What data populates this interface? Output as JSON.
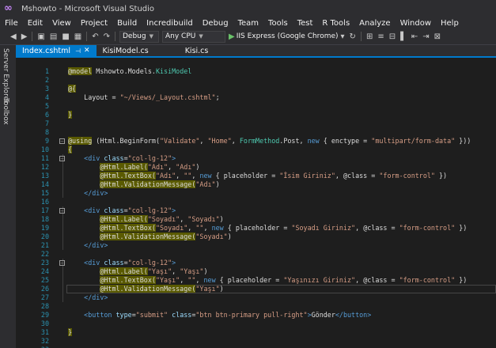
{
  "window": {
    "title": "Mshowto - Microsoft Visual Studio"
  },
  "menu": [
    "File",
    "Edit",
    "View",
    "Project",
    "Build",
    "Incredibuild",
    "Debug",
    "Team",
    "Tools",
    "Test",
    "R Tools",
    "Analyze",
    "Window",
    "Help"
  ],
  "toolbar": {
    "config": "Debug",
    "platform": "Any CPU",
    "run_target": "IIS Express (Google Chrome)"
  },
  "side_tabs": [
    "Server Explorer",
    "Toolbox"
  ],
  "tabs": [
    {
      "label": "Index.cshtml",
      "active": true
    },
    {
      "label": "KisiModel.cs",
      "active": false
    },
    {
      "label": "Kisi.cs",
      "active": false
    }
  ],
  "colors": {
    "accent": "#007acc",
    "line_number": "#2b91af",
    "keyword": "#569cd6",
    "string": "#d69d85",
    "type": "#4ec9b0"
  },
  "icons": [
    "vs-logo-icon",
    "back-icon",
    "forward-icon",
    "new-item-icon",
    "open-icon",
    "save-icon",
    "save-all-icon",
    "undo-icon",
    "redo-icon",
    "play-icon",
    "refresh-icon"
  ],
  "code_lines": [
    {
      "n": "1",
      "segs": [
        [
          "razor",
          "@model"
        ],
        [
          "",
          " Mshowto.Models."
        ],
        [
          "type",
          "KisiModel"
        ]
      ]
    },
    {
      "n": "2",
      "segs": [
        [
          "",
          ""
        ]
      ]
    },
    {
      "n": "3",
      "segs": [
        [
          "razor",
          "@{"
        ]
      ]
    },
    {
      "n": "4",
      "segs": [
        [
          "",
          "    Layout = "
        ],
        [
          "str",
          "\"~/Views/_Layout.cshtml\""
        ],
        [
          "",
          ";"
        ]
      ]
    },
    {
      "n": "5",
      "segs": [
        [
          "",
          ""
        ]
      ]
    },
    {
      "n": "6",
      "segs": [
        [
          "razor",
          "}"
        ]
      ]
    },
    {
      "n": "7",
      "segs": [
        [
          "",
          ""
        ]
      ]
    },
    {
      "n": "8",
      "segs": [
        [
          "",
          ""
        ]
      ]
    },
    {
      "n": "9",
      "segs": [
        [
          "razor",
          "@using"
        ],
        [
          "",
          " (Html.BeginForm("
        ],
        [
          "str",
          "\"Validate\""
        ],
        [
          "",
          ", "
        ],
        [
          "str",
          "\"Home\""
        ],
        [
          "",
          ", "
        ],
        [
          "type",
          "FormMethod"
        ],
        [
          "",
          ".Post, "
        ],
        [
          "kw",
          "new"
        ],
        [
          "",
          " { enctype = "
        ],
        [
          "str",
          "\"multipart/form-data\""
        ],
        [
          "",
          " }))"
        ]
      ]
    },
    {
      "n": "10",
      "segs": [
        [
          "razor",
          "{"
        ]
      ]
    },
    {
      "n": "11",
      "segs": [
        [
          "",
          "    "
        ],
        [
          "tag",
          "<div"
        ],
        [
          "attr",
          " class"
        ],
        [
          "",
          "="
        ],
        [
          "str",
          "\"col-lg-12\""
        ],
        [
          "tag",
          ">"
        ]
      ]
    },
    {
      "n": "12",
      "segs": [
        [
          "",
          "        "
        ],
        [
          "razor",
          "@Html.Label("
        ],
        [
          "str",
          "\"Adı\""
        ],
        [
          "",
          ", "
        ],
        [
          "str",
          "\"Adı\""
        ],
        [
          "",
          ")"
        ]
      ]
    },
    {
      "n": "13",
      "segs": [
        [
          "",
          "        "
        ],
        [
          "razor",
          "@Html.TextBox("
        ],
        [
          "str",
          "\"Adı\""
        ],
        [
          "",
          ", "
        ],
        [
          "str",
          "\"\""
        ],
        [
          "",
          ", "
        ],
        [
          "kw",
          "new"
        ],
        [
          "",
          " { placeholder = "
        ],
        [
          "str",
          "\"İsim Giriniz\""
        ],
        [
          "",
          ", @class = "
        ],
        [
          "str",
          "\"form-control\""
        ],
        [
          "",
          " })"
        ]
      ]
    },
    {
      "n": "14",
      "segs": [
        [
          "",
          "        "
        ],
        [
          "razor",
          "@Html.ValidationMessage("
        ],
        [
          "str",
          "\"Adı\""
        ],
        [
          "",
          ")"
        ]
      ]
    },
    {
      "n": "15",
      "segs": [
        [
          "",
          "    "
        ],
        [
          "tag",
          "</div>"
        ]
      ]
    },
    {
      "n": "16",
      "segs": [
        [
          "",
          ""
        ]
      ]
    },
    {
      "n": "17",
      "segs": [
        [
          "",
          "    "
        ],
        [
          "tag",
          "<div"
        ],
        [
          "attr",
          " class"
        ],
        [
          "",
          "="
        ],
        [
          "str",
          "\"col-lg-12\""
        ],
        [
          "tag",
          ">"
        ]
      ]
    },
    {
      "n": "18",
      "segs": [
        [
          "",
          "        "
        ],
        [
          "razor",
          "@Html.Label("
        ],
        [
          "str",
          "\"Soyadı\""
        ],
        [
          "",
          ", "
        ],
        [
          "str",
          "\"Soyadı\""
        ],
        [
          "",
          ")"
        ]
      ]
    },
    {
      "n": "19",
      "segs": [
        [
          "",
          "        "
        ],
        [
          "razor",
          "@Html.TextBox("
        ],
        [
          "str",
          "\"Soyadı\""
        ],
        [
          "",
          ", "
        ],
        [
          "str",
          "\"\""
        ],
        [
          "",
          ", "
        ],
        [
          "kw",
          "new"
        ],
        [
          "",
          " { placeholder = "
        ],
        [
          "str",
          "\"Soyadı Giriniz\""
        ],
        [
          "",
          ", @class = "
        ],
        [
          "str",
          "\"form-control\""
        ],
        [
          "",
          " })"
        ]
      ]
    },
    {
      "n": "20",
      "segs": [
        [
          "",
          "        "
        ],
        [
          "razor",
          "@Html.ValidationMessage("
        ],
        [
          "str",
          "\"Soyadı\""
        ],
        [
          "",
          ")"
        ]
      ]
    },
    {
      "n": "21",
      "segs": [
        [
          "",
          "    "
        ],
        [
          "tag",
          "</div>"
        ]
      ]
    },
    {
      "n": "22",
      "segs": [
        [
          "",
          ""
        ]
      ]
    },
    {
      "n": "23",
      "segs": [
        [
          "",
          "    "
        ],
        [
          "tag",
          "<div"
        ],
        [
          "attr",
          " class"
        ],
        [
          "",
          "="
        ],
        [
          "str",
          "\"col-lg-12\""
        ],
        [
          "tag",
          ">"
        ]
      ]
    },
    {
      "n": "24",
      "segs": [
        [
          "",
          "        "
        ],
        [
          "razor",
          "@Html.Label("
        ],
        [
          "str",
          "\"Yaşı\""
        ],
        [
          "",
          ", "
        ],
        [
          "str",
          "\"Yaşı\""
        ],
        [
          "",
          ")"
        ]
      ]
    },
    {
      "n": "25",
      "segs": [
        [
          "",
          "        "
        ],
        [
          "razor",
          "@Html.TextBox("
        ],
        [
          "str",
          "\"Yaşı\""
        ],
        [
          "",
          ", "
        ],
        [
          "str",
          "\"\""
        ],
        [
          "",
          ", "
        ],
        [
          "kw",
          "new"
        ],
        [
          "",
          " { placeholder = "
        ],
        [
          "str",
          "\"Yaşınızı Giriniz\""
        ],
        [
          "",
          ", @class = "
        ],
        [
          "str",
          "\"form-control\""
        ],
        [
          "",
          " })"
        ]
      ]
    },
    {
      "n": "26",
      "segs": [
        [
          "",
          "        "
        ],
        [
          "razor",
          "@Html.ValidationMessage("
        ],
        [
          "str",
          "\"Yaşı\""
        ],
        [
          "",
          ")"
        ]
      ]
    },
    {
      "n": "27",
      "segs": [
        [
          "",
          "    "
        ],
        [
          "tag",
          "</div>"
        ]
      ]
    },
    {
      "n": "28",
      "segs": [
        [
          "",
          ""
        ]
      ]
    },
    {
      "n": "29",
      "segs": [
        [
          "",
          "    "
        ],
        [
          "tag",
          "<button"
        ],
        [
          "attr",
          " type"
        ],
        [
          "",
          "="
        ],
        [
          "str",
          "\"submit\""
        ],
        [
          "attr",
          " class"
        ],
        [
          "",
          "="
        ],
        [
          "str",
          "\"btn btn-primary pull-right\""
        ],
        [
          "tag",
          ">"
        ],
        [
          "",
          "Gönder"
        ],
        [
          "tag",
          "</button>"
        ]
      ]
    },
    {
      "n": "30",
      "segs": [
        [
          "",
          ""
        ]
      ]
    },
    {
      "n": "31",
      "segs": [
        [
          "razor",
          "}"
        ]
      ]
    },
    {
      "n": "32",
      "segs": [
        [
          "",
          ""
        ]
      ]
    },
    {
      "n": "33",
      "segs": [
        [
          "",
          ""
        ]
      ]
    }
  ]
}
